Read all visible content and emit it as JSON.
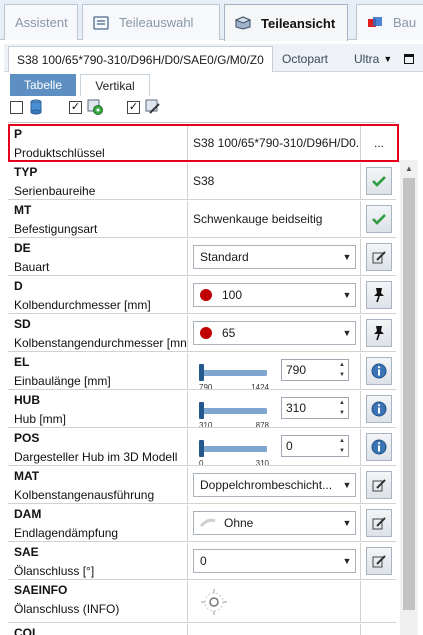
{
  "top_tabs": [
    {
      "label": "Assistent",
      "icon": "none"
    },
    {
      "label": "Teileauswahl",
      "icon": "list-icon"
    },
    {
      "label": "Teileansicht",
      "icon": "part-view-icon"
    },
    {
      "label": "Bau",
      "icon": "assembly-icon"
    }
  ],
  "key_bar": {
    "part_key": "S38 100/65*790-310/D96H/D0/SAE0/G/M0/Z0",
    "octopart": "Octopart",
    "ultra": "Ultra",
    "ultra_arrow": "▼"
  },
  "sub_tabs": {
    "table": "Tabelle",
    "vertical": "Vertikal"
  },
  "toolbar": {
    "checkboxes": [
      {
        "checked": false,
        "icon": "cylinder-icon"
      },
      {
        "checked": true,
        "icon": "green-settings-icon"
      },
      {
        "checked": true,
        "icon": "edit-settings-icon"
      }
    ]
  },
  "rows": [
    {
      "code": "P",
      "desc": "Produktschlüssel",
      "value": "S38 100/65*790-310/D96H/D0...",
      "action": "none",
      "action_label": "..."
    },
    {
      "code": "TYP",
      "desc": "Serienbaureihe",
      "value": "S38",
      "action": "check-icon"
    },
    {
      "code": "MT",
      "desc": "Befestigungsart",
      "value": "Schwenkauge beidseitig",
      "action": "check-icon"
    },
    {
      "code": "DE",
      "desc": "Bauart",
      "select": "Standard",
      "action": "edit-icon"
    },
    {
      "code": "D",
      "desc": "Kolbendurchmesser [mm]",
      "select": "100",
      "dot": true,
      "action": "pin-icon"
    },
    {
      "code": "SD",
      "desc": "Kolbenstangendurchmesser [mn",
      "select": "65",
      "dot": true,
      "action": "pin-icon"
    },
    {
      "code": "EL",
      "desc": "Einbaulänge [mm]",
      "slider": {
        "min": "790",
        "max": "1424",
        "value": "790",
        "fraction": 0.0
      },
      "action": "info-icon"
    },
    {
      "code": "HUB",
      "desc": "Hub [mm]",
      "slider": {
        "min": "310",
        "max": "878",
        "value": "310",
        "fraction": 0.0
      },
      "action": "info-icon"
    },
    {
      "code": "POS",
      "desc": "Dargesteller Hub im 3D Modell",
      "slider": {
        "min": "0",
        "max": "310",
        "value": "0",
        "fraction": 0.0
      },
      "action": "info-icon"
    },
    {
      "code": "MAT",
      "desc": "Kolbenstangenausführung",
      "select": "Doppelchrombeschicht...",
      "action": "edit-icon"
    },
    {
      "code": "DAM",
      "desc": "Endlagendämpfung",
      "select": "Ohne",
      "swatch": true,
      "action": "edit-icon"
    },
    {
      "code": "SAE",
      "desc": "Ölanschluss [°]",
      "select": "0",
      "action": "edit-icon"
    },
    {
      "code": "SAEINFO",
      "desc": "Ölanschluss (INFO)",
      "image": "oil-port-icon",
      "action": "none"
    },
    {
      "code": "COL",
      "desc": "",
      "action": "none"
    }
  ],
  "colors": {
    "highlight": "#e3001b",
    "accent": "#5d8fc2",
    "check": "#2e9c3f",
    "info": "#3a74b5"
  }
}
